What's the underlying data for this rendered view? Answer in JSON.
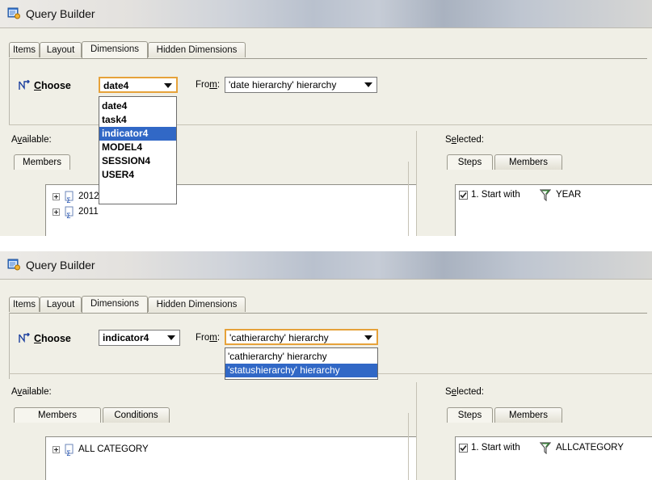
{
  "screen1": {
    "window_title": "Query Builder",
    "tabs": [
      "Items",
      "Layout",
      "Dimensions",
      "Hidden Dimensions"
    ],
    "active_tab": "Dimensions",
    "choose_label": "Choose",
    "choose_value": "date4",
    "from_label": "From:",
    "from_value": "'date hierarchy' hierarchy",
    "dropdown_open": "choose",
    "dropdown_items": [
      "date4",
      "task4",
      "indicator4",
      "MODEL4",
      "SESSION4",
      "USER4"
    ],
    "dropdown_highlighted": "indicator4",
    "available_label": "Available:",
    "available_tabs": [
      "Members"
    ],
    "tree_items": [
      "2012",
      "2011"
    ],
    "selected_label": "Selected:",
    "selected_tabs": [
      "Steps",
      "Members"
    ],
    "steps": [
      {
        "checked": true,
        "text": "1. Start with",
        "value": "YEAR"
      }
    ]
  },
  "screen2": {
    "window_title": "Query Builder",
    "tabs": [
      "Items",
      "Layout",
      "Dimensions",
      "Hidden Dimensions"
    ],
    "active_tab": "Dimensions",
    "choose_label": "Choose",
    "choose_value": "indicator4",
    "from_label": "From:",
    "from_value": "'cathierarchy' hierarchy",
    "dropdown_open": "from",
    "dropdown_items": [
      "'cathierarchy' hierarchy",
      "'statushierarchy' hierarchy"
    ],
    "dropdown_highlighted": "'statushierarchy' hierarchy",
    "available_label": "Available:",
    "available_tabs": [
      "Members",
      "Conditions"
    ],
    "tree_items": [
      "ALL CATEGORY"
    ],
    "selected_label": "Selected:",
    "selected_tabs": [
      "Steps",
      "Members"
    ],
    "steps": [
      {
        "checked": true,
        "text": "1. Start with",
        "value": "ALLCATEGORY"
      }
    ]
  },
  "colors": {
    "highlight": "#3168c6",
    "panel_bg": "#f0efe6"
  },
  "icons": [
    "query-builder-app-icon",
    "choose-dimension-icon",
    "tree-node-icon",
    "filter-funnel-icon"
  ]
}
